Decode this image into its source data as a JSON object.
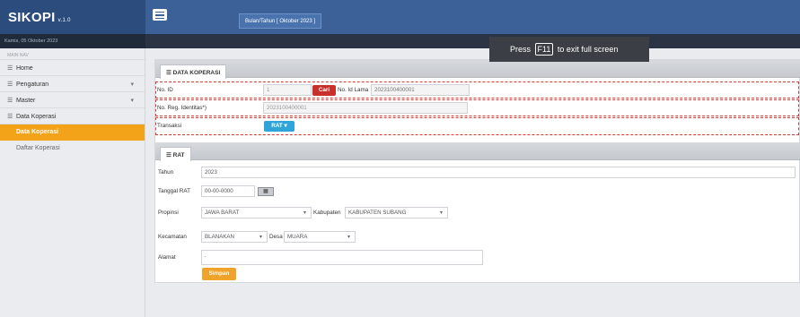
{
  "app": {
    "logo": "SIKOPI",
    "version": "v.1.0",
    "period_label": "Bulan/Tahun [ Oktober 2023 ]",
    "date_text": "Kamis, 05 Oktober 2023"
  },
  "toast": {
    "prefix": "Press",
    "key": "F11",
    "suffix": "to exit full screen"
  },
  "sidebar": {
    "heading": "MAIN NAV",
    "items": [
      {
        "label": "Home",
        "icon": "list-icon",
        "has_children": false
      },
      {
        "label": "Pengaturan",
        "icon": "list-icon",
        "has_children": true
      },
      {
        "label": "Master",
        "icon": "list-icon",
        "has_children": true
      },
      {
        "label": "Data Koperasi",
        "icon": "list-icon",
        "has_children": false
      }
    ],
    "subitems": [
      {
        "label": "Data Koperasi",
        "active": true
      },
      {
        "label": "Daftar Koperasi",
        "active": false
      }
    ]
  },
  "data_koperasi": {
    "tab": "DATA KOPERASI",
    "no_id_label": "No. ID",
    "no_id_value": "1",
    "cari_label": "Cari",
    "no_id_lama_label": "No. Id Lama",
    "no_id_lama_value": "2023100400001",
    "reg_label": "No. Reg. Identitas*)",
    "reg_value": "2023100400001",
    "transaksi_label": "Transaksi",
    "transaksi_button": "RAT"
  },
  "rat": {
    "tab": "RAT",
    "tahun_label": "Tahun",
    "tahun_value": "2023",
    "tanggal_label": "Tanggal RAT",
    "tanggal_value": "00-00-0000",
    "propinsi_label": "Propinsi",
    "propinsi_value": "JAWA BARAT",
    "kabupaten_label": "Kabupaten",
    "kabupaten_value": "KABUPATEN SUBANG",
    "kecamatan_label": "Kecamatan",
    "kecamatan_value": "BLANAKAN",
    "desa_label": "Desa",
    "desa_value": "MUARA",
    "alamat_label": "Alamat",
    "alamat_value": ".",
    "simpan_label": "Simpan"
  },
  "colors": {
    "topbar": "#3c6198",
    "brand": "#2b4c7c",
    "active": "#f3a318",
    "danger": "#c9302c",
    "info": "#2fa4d9",
    "warning": "#f0a32a",
    "dashed": "#d23a3a"
  }
}
